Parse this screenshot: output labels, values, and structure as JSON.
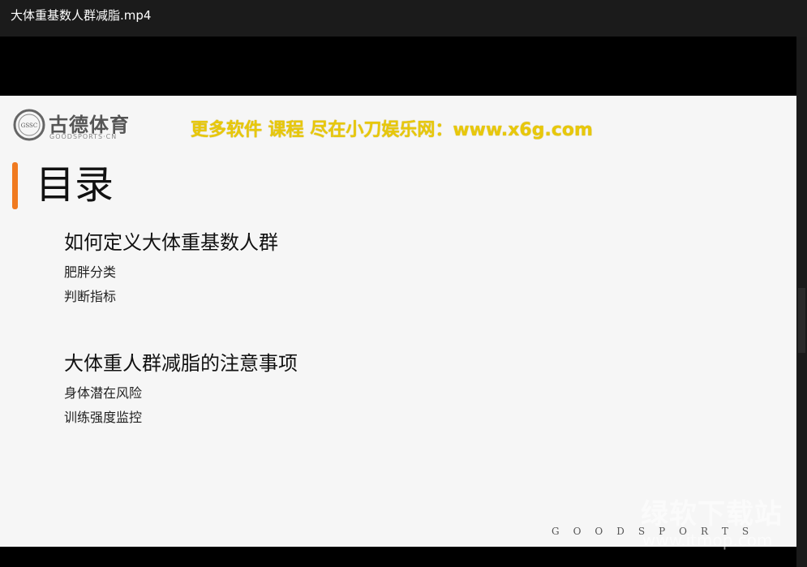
{
  "window": {
    "title": "大体重基数人群减脂.mp4"
  },
  "slide": {
    "logo": {
      "seal_text": "GSSC",
      "name": "古德体育",
      "subtitle": "GOODSPORTS·CN"
    },
    "watermark_text": "更多软件 课程 尽在小刀娱乐网：www.x6g.com",
    "heading": "目录",
    "sections": [
      {
        "title": "如何定义大体重基数人群",
        "items": [
          "肥胖分类",
          "判断指标"
        ]
      },
      {
        "title": "大体重人群减脂的注意事项",
        "items": [
          "身体潜在风险",
          "训练强度监控"
        ]
      }
    ],
    "footer_brand": "GOODSPORTS"
  },
  "site_watermark": {
    "title": "绿软下载站",
    "url": "www.itmop.com"
  },
  "colors": {
    "accent": "#f07a20",
    "watermark": "#e8c80a",
    "slide_bg": "#f6f6f6",
    "titlebar_bg": "#1b1b1b"
  }
}
